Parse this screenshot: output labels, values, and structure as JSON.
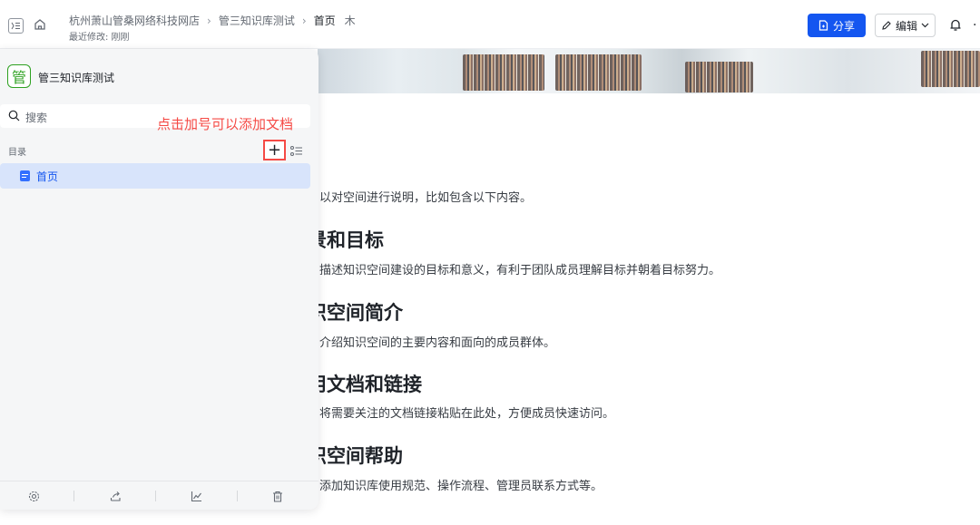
{
  "header": {
    "breadcrumbs": [
      "杭州萧山管桑网络科技网店",
      "管三知识库测试",
      "首页"
    ],
    "pin_glyph": "⽊",
    "last_modified": "最近修改: 刚刚",
    "share_label": "分享",
    "edit_label": "编辑",
    "more_glyph": "·"
  },
  "sidebar": {
    "space_logo_char": "管",
    "space_name": "管三知识库测试",
    "search_placeholder": "搜索",
    "annotation": "点击加号可以添加文档",
    "toc_label": "目录",
    "add_glyph": "+",
    "items": [
      {
        "label": "首页",
        "icon": "doc-icon",
        "selected": true
      }
    ],
    "footer_icons": [
      "gear-icon",
      "share-icon",
      "chart-icon",
      "trash-icon"
    ]
  },
  "document": {
    "intro": "以对空间进行说明，比如包含以下内容。",
    "sections": [
      {
        "heading": "景和目标",
        "body": "描述知识空间建设的目标和意义，有利于团队成员理解目标并朝着目标努力。"
      },
      {
        "heading": "识空间简介",
        "body": "介绍知识空间的主要内容和面向的成员群体。"
      },
      {
        "heading": "用文档和链接",
        "body": "将需要关注的文档链接粘贴在此处，方便成员快速访问。"
      },
      {
        "heading": "识空间帮助",
        "body": "添加知识库使用规范、操作流程、管理员联系方式等。"
      }
    ]
  },
  "colors": {
    "accent": "#1456f0",
    "annotation": "#f54a45",
    "space_logo": "#2ea121"
  }
}
